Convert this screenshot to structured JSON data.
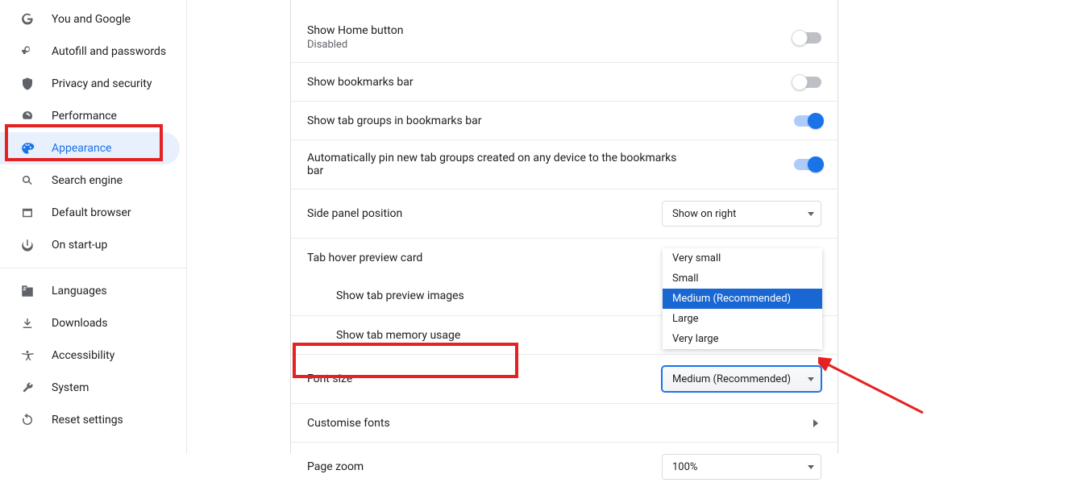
{
  "sidebar": {
    "items": [
      {
        "label": "You and Google",
        "selected": false
      },
      {
        "label": "Autofill and passwords",
        "selected": false
      },
      {
        "label": "Privacy and security",
        "selected": false
      },
      {
        "label": "Performance",
        "selected": false
      },
      {
        "label": "Appearance",
        "selected": true
      },
      {
        "label": "Search engine",
        "selected": false
      },
      {
        "label": "Default browser",
        "selected": false
      },
      {
        "label": "On start-up",
        "selected": false
      }
    ],
    "secondary": [
      {
        "label": "Languages"
      },
      {
        "label": "Downloads"
      },
      {
        "label": "Accessibility"
      },
      {
        "label": "System"
      },
      {
        "label": "Reset settings"
      }
    ]
  },
  "settings": {
    "showHome": {
      "label": "Show Home button",
      "sub": "Disabled",
      "on": false
    },
    "bookmarksBar": {
      "label": "Show bookmarks bar",
      "on": false
    },
    "tabGroupsBookmarks": {
      "label": "Show tab groups in bookmarks bar",
      "on": true
    },
    "autoPinTabGroups": {
      "label": "Automatically pin new tab groups created on any device to the bookmarks bar",
      "on": true
    },
    "sidePanel": {
      "label": "Side panel position",
      "value": "Show on right"
    },
    "tabHover": {
      "label": "Tab hover preview card"
    },
    "tabPreviewImages": {
      "label": "Show tab preview images"
    },
    "tabMemory": {
      "label": "Show tab memory usage"
    },
    "fontSize": {
      "label": "Font size",
      "value": "Medium (Recommended)",
      "options": [
        "Very small",
        "Small",
        "Medium (Recommended)",
        "Large",
        "Very large"
      ]
    },
    "customiseFonts": {
      "label": "Customise fonts"
    },
    "pageZoom": {
      "label": "Page zoom",
      "value": "100%"
    }
  }
}
